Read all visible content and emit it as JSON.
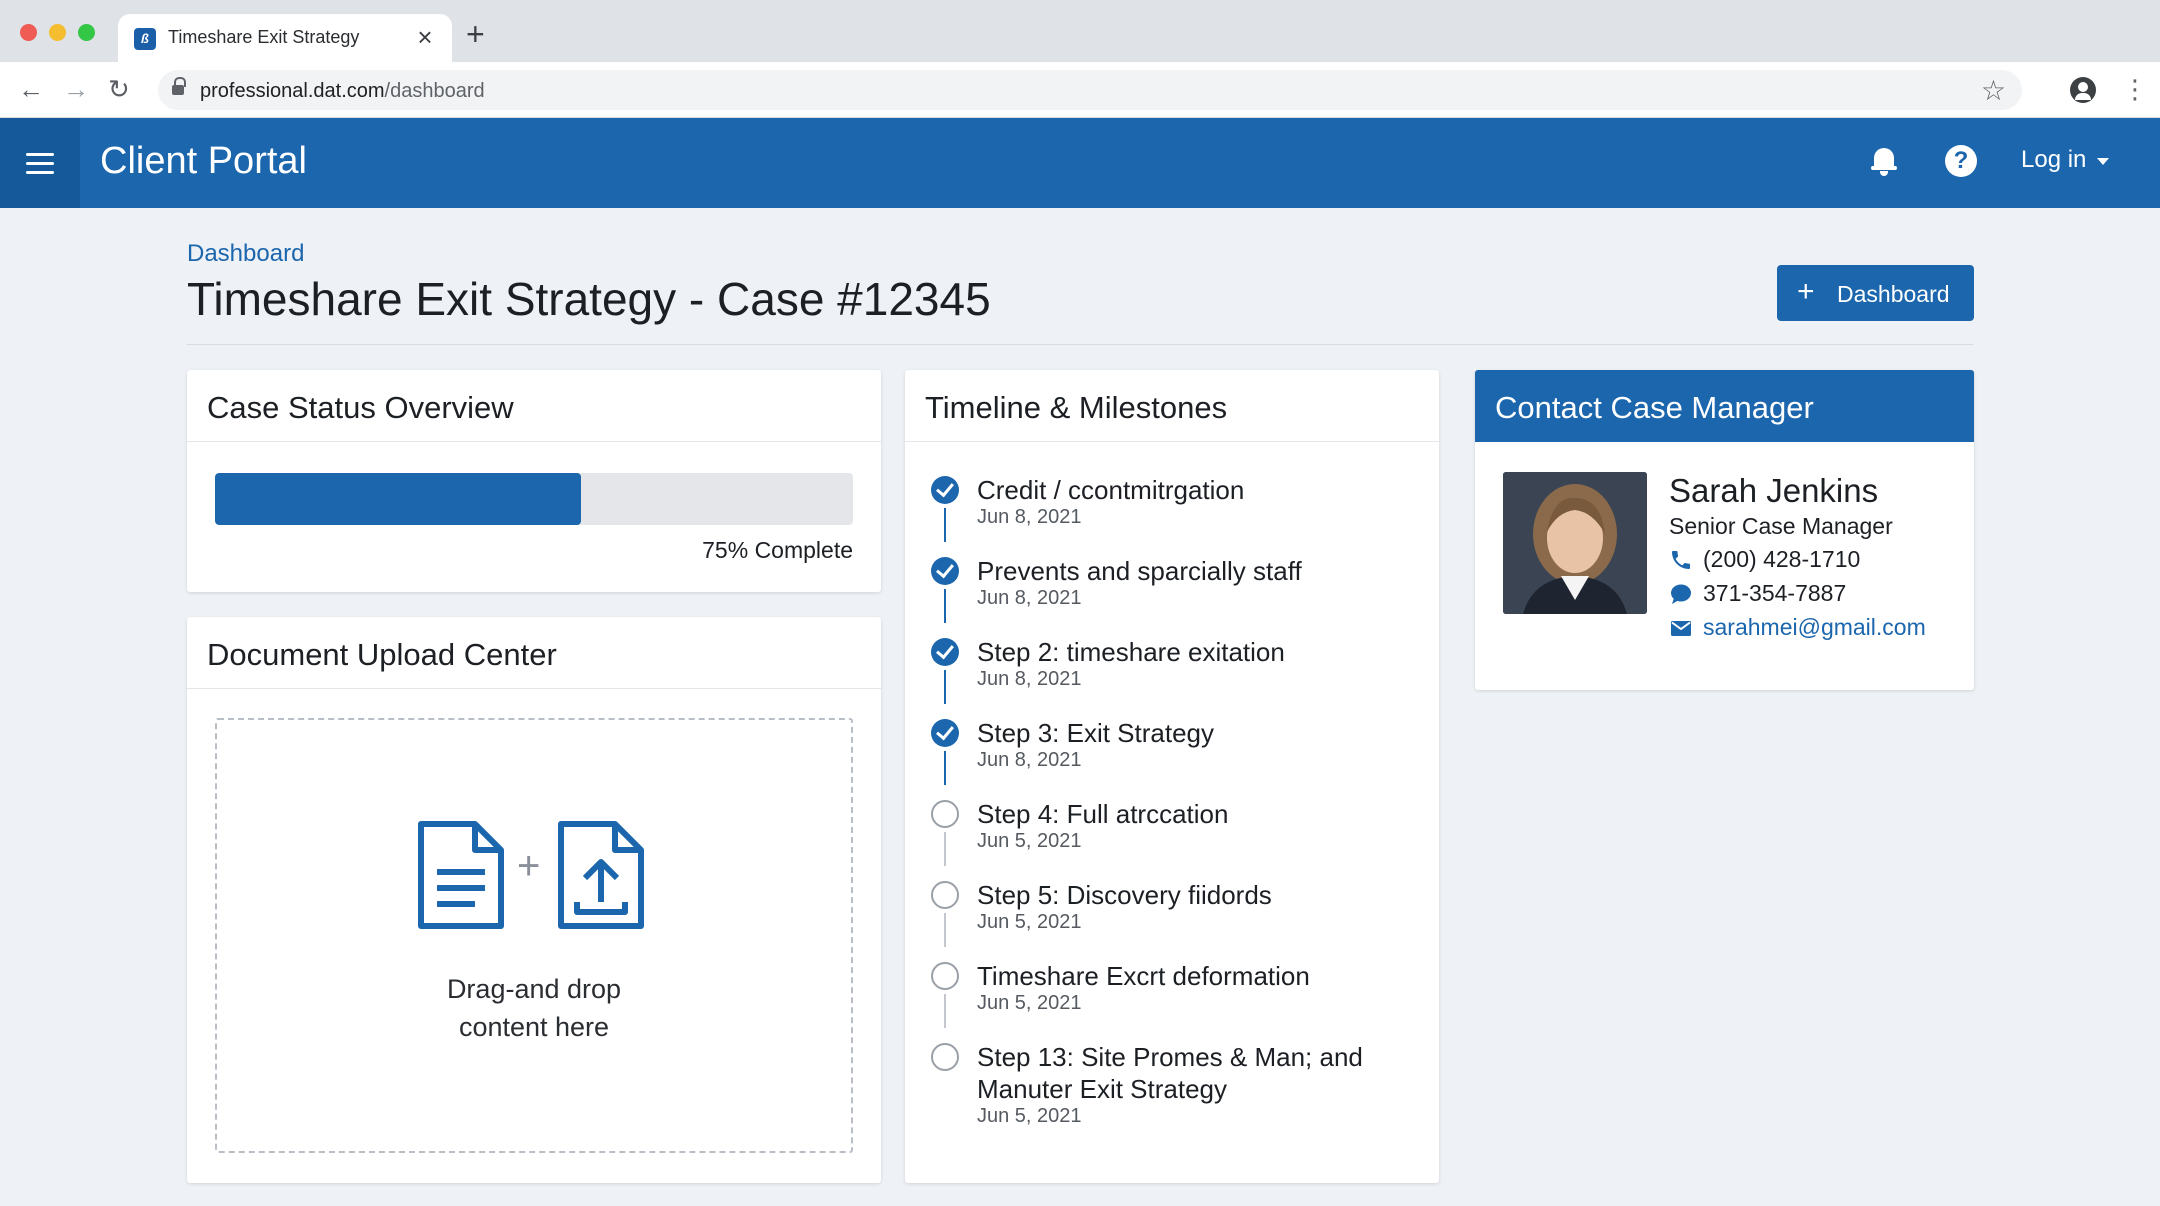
{
  "browser": {
    "tab_title": "Timeshare Exit Strategy",
    "tab_close": "×",
    "new_tab": "+",
    "url_host": "professional.dat.com",
    "url_path": "/dashboard"
  },
  "appbar": {
    "title": "Client Portal",
    "login_label": "Log in",
    "help_label": "?"
  },
  "page": {
    "breadcrumb": "Dashboard",
    "title": "Timeshare Exit Strategy - Case #12345",
    "action_button": "Dashboard"
  },
  "status": {
    "title": "Case Status Overview",
    "progress": 0.75,
    "progress_text": "75% Complete"
  },
  "upload": {
    "title": "Document Upload Center",
    "plus": "+",
    "drop_line1": "Drag-and drop",
    "drop_line2": "content here"
  },
  "timeline": {
    "title": "Timeline & Milestones",
    "items": [
      {
        "label": "Credit / ccontmitrgation",
        "date": "Jun 8, 2021",
        "done": true
      },
      {
        "label": "Prevents and sparcially staff",
        "date": "Jun 8, 2021",
        "done": true
      },
      {
        "label": "Step 2: timeshare exitation",
        "date": "Jun 8, 2021",
        "done": true
      },
      {
        "label": "Step 3: Exit Strategy",
        "date": "Jun 8, 2021",
        "done": true
      },
      {
        "label": "Step 4: Full atrccation",
        "date": "Jun 5, 2021",
        "done": false
      },
      {
        "label": "Step 5: Discovery fiidords",
        "date": "Jun 5, 2021",
        "done": false
      },
      {
        "label": "Timeshare Excrt deformation",
        "date": "Jun 5, 2021",
        "done": false
      },
      {
        "label": "Step 13: Site Promes & Man; and Manuter Exit Strategy",
        "date": "Jun 5, 2021",
        "done": false
      }
    ]
  },
  "contact": {
    "title": "Contact Case Manager",
    "name": "Sarah Jenkins",
    "role": "Senior Case Manager",
    "phone": "(200) 428-1710",
    "message": "371-354-7887",
    "email": "sarahmei@gmail.com"
  },
  "colors": {
    "primary": "#1b66ad",
    "primary_dark": "#15599a",
    "background": "#eef1f5"
  },
  "icons": [
    "menu-icon",
    "bell-icon",
    "help-icon",
    "caret-down-icon",
    "plus-icon",
    "document-icon",
    "upload-icon",
    "check-circle-icon",
    "empty-circle-icon",
    "phone-icon",
    "chat-icon",
    "mail-icon"
  ]
}
